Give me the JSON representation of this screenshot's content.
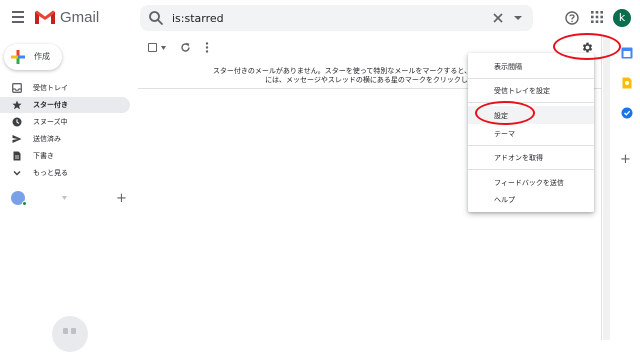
{
  "app": {
    "brand": "Gmail"
  },
  "search": {
    "value": "is:starred",
    "icon": "search-icon"
  },
  "header": {
    "avatar_letter": "k"
  },
  "compose": {
    "label": "作成"
  },
  "sidebar": {
    "items": [
      {
        "label": "受信トレイ",
        "icon": "inbox-icon",
        "active": false
      },
      {
        "label": "スター付き",
        "icon": "star-icon",
        "active": true
      },
      {
        "label": "スヌーズ中",
        "icon": "clock-icon",
        "active": false
      },
      {
        "label": "送信済み",
        "icon": "send-icon",
        "active": false
      },
      {
        "label": "下書き",
        "icon": "draft-icon",
        "active": false
      },
      {
        "label": "もっと見る",
        "icon": "chevron-down-icon",
        "active": false
      }
    ]
  },
  "main": {
    "empty_message": "スター付きのメールがありません。スターを使って特別なメールをマークすると、メールを見つけや\nには、メッセージやスレッドの横にある星のマークをクリックしま"
  },
  "menu": {
    "items": [
      {
        "label": "表示間隔"
      },
      {
        "label": "受信トレイを設定"
      },
      {
        "label": "設定"
      },
      {
        "label": "テーマ"
      },
      {
        "label": "アドオンを取得"
      },
      {
        "label": "フィードバックを送信"
      },
      {
        "label": "ヘルプ"
      }
    ]
  },
  "colors": {
    "annotation": "#e8101a",
    "active_nav": "#e8eaed",
    "avatar": "#0b6e4f"
  }
}
